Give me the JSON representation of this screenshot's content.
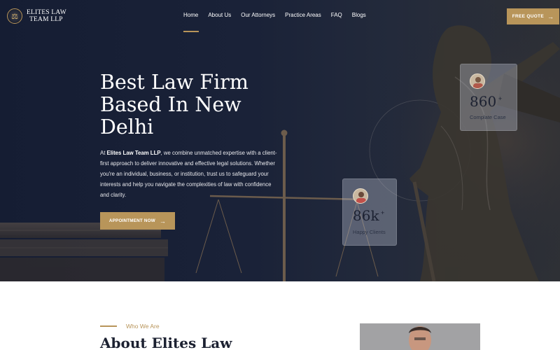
{
  "brand": {
    "line1": "ELITES LAW",
    "line2": "TEAM LLP",
    "emblem_icon": "scales-emblem-icon"
  },
  "nav": [
    {
      "label": "Home",
      "active": true
    },
    {
      "label": "About Us"
    },
    {
      "label": "Our Attorneys"
    },
    {
      "label": "Practice Areas"
    },
    {
      "label": "FAQ"
    },
    {
      "label": "Blogs"
    }
  ],
  "header": {
    "quote_label": "FREE QUOTE",
    "arrow": "→"
  },
  "hero": {
    "title_lines": [
      "Best Law Firm",
      "Based In New",
      "Delhi"
    ],
    "desc_pre": "At ",
    "desc_bold": "Elites Law Team LLP",
    "desc_post": ", we combine unmatched expertise with a client-first approach to deliver innovative and effective legal solutions. Whether you're an individual, business, or institution, trust us to safeguard your interests and help you navigate the complexities of law with confidence and clarity.",
    "button_label": "APPOINTMENT NOW",
    "button_arrow": "→"
  },
  "stats": [
    {
      "value": "860",
      "suffix": "+",
      "label": "Complate Case"
    },
    {
      "value": "86k",
      "suffix": "+",
      "label": "Happy Clients"
    }
  ],
  "about": {
    "eyebrow": "Who We Are",
    "title": "About Elites Law"
  },
  "colors": {
    "accent": "#b8955a",
    "navy": "#1c2131"
  }
}
